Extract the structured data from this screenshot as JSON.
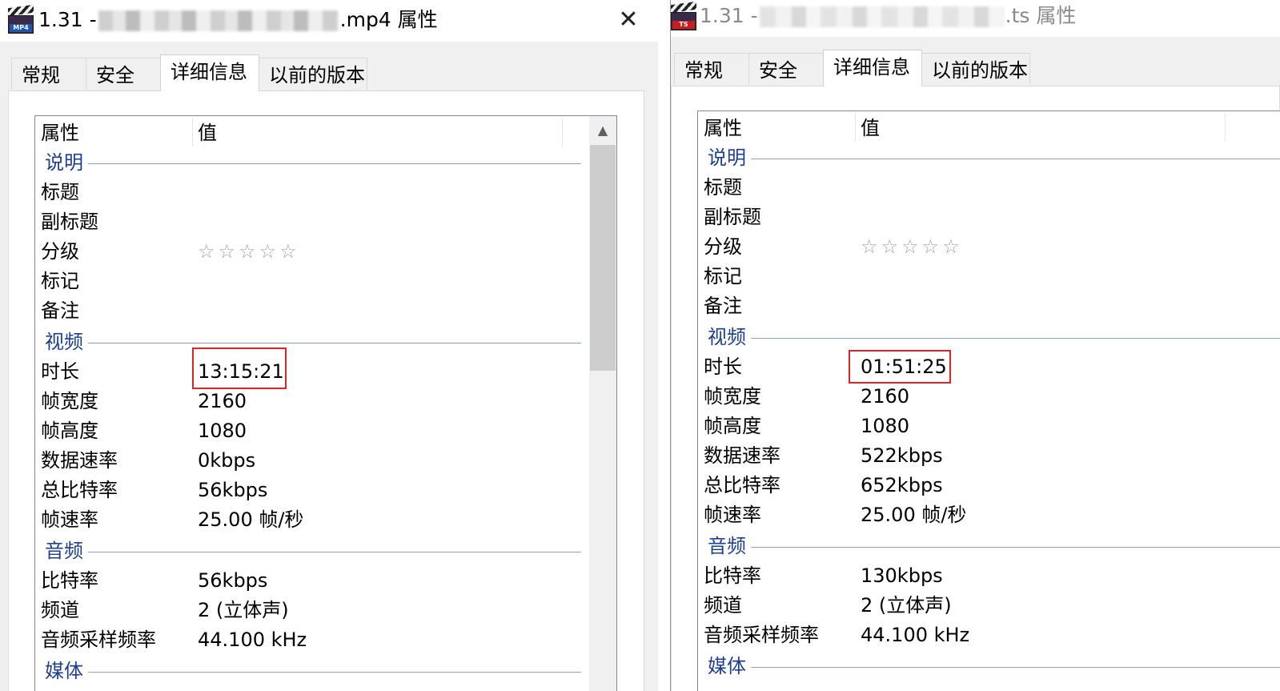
{
  "left_window": {
    "icon_badge": "MP4",
    "title_prefix": "1.31 - ",
    "title_suffix": ".mp4 属性",
    "close_label": "✕",
    "tabs": [
      "常规",
      "安全",
      "详细信息",
      "以前的版本"
    ],
    "active_tab": "详细信息",
    "columns": {
      "property": "属性",
      "value": "值"
    },
    "groups": {
      "description": "说明",
      "video": "视频",
      "audio": "音频",
      "media": "媒体"
    },
    "rows": {
      "title": {
        "name": "标题",
        "value": ""
      },
      "subtitle": {
        "name": "副标题",
        "value": ""
      },
      "rating": {
        "name": "分级",
        "value": "☆☆☆☆☆"
      },
      "tags": {
        "name": "标记",
        "value": ""
      },
      "comments": {
        "name": "备注",
        "value": ""
      },
      "duration": {
        "name": "时长",
        "value": "13:15:21"
      },
      "frame_width": {
        "name": "帧宽度",
        "value": "2160"
      },
      "frame_height": {
        "name": "帧高度",
        "value": "1080"
      },
      "data_rate": {
        "name": "数据速率",
        "value": "0kbps"
      },
      "total_bitrate": {
        "name": "总比特率",
        "value": "56kbps"
      },
      "frame_rate": {
        "name": "帧速率",
        "value": "25.00 帧/秒"
      },
      "audio_bitrate": {
        "name": "比特率",
        "value": "56kbps"
      },
      "channels": {
        "name": "频道",
        "value": "2 (立体声)"
      },
      "sample_rate": {
        "name": "音频采样频率",
        "value": "44.100 kHz"
      }
    }
  },
  "right_window": {
    "icon_badge": "TS",
    "title_prefix": "1.31 - ",
    "title_suffix": ".ts 属性",
    "tabs": [
      "常规",
      "安全",
      "详细信息",
      "以前的版本"
    ],
    "active_tab": "详细信息",
    "columns": {
      "property": "属性",
      "value": "值"
    },
    "groups": {
      "description": "说明",
      "video": "视频",
      "audio": "音频",
      "media": "媒体"
    },
    "rows": {
      "title": {
        "name": "标题",
        "value": ""
      },
      "subtitle": {
        "name": "副标题",
        "value": ""
      },
      "rating": {
        "name": "分级",
        "value": "☆☆☆☆☆"
      },
      "tags": {
        "name": "标记",
        "value": ""
      },
      "comments": {
        "name": "备注",
        "value": ""
      },
      "duration": {
        "name": "时长",
        "value": "01:51:25"
      },
      "frame_width": {
        "name": "帧宽度",
        "value": "2160"
      },
      "frame_height": {
        "name": "帧高度",
        "value": "1080"
      },
      "data_rate": {
        "name": "数据速率",
        "value": "522kbps"
      },
      "total_bitrate": {
        "name": "总比特率",
        "value": "652kbps"
      },
      "frame_rate": {
        "name": "帧速率",
        "value": "25.00 帧/秒"
      },
      "audio_bitrate": {
        "name": "比特率",
        "value": "130kbps"
      },
      "channels": {
        "name": "频道",
        "value": "2 (立体声)"
      },
      "sample_rate": {
        "name": "音频采样频率",
        "value": "44.100 kHz"
      }
    }
  },
  "colors": {
    "group_heading": "#1e3f8f",
    "highlight_box": "#e02424",
    "star": "#a6a6a6"
  }
}
